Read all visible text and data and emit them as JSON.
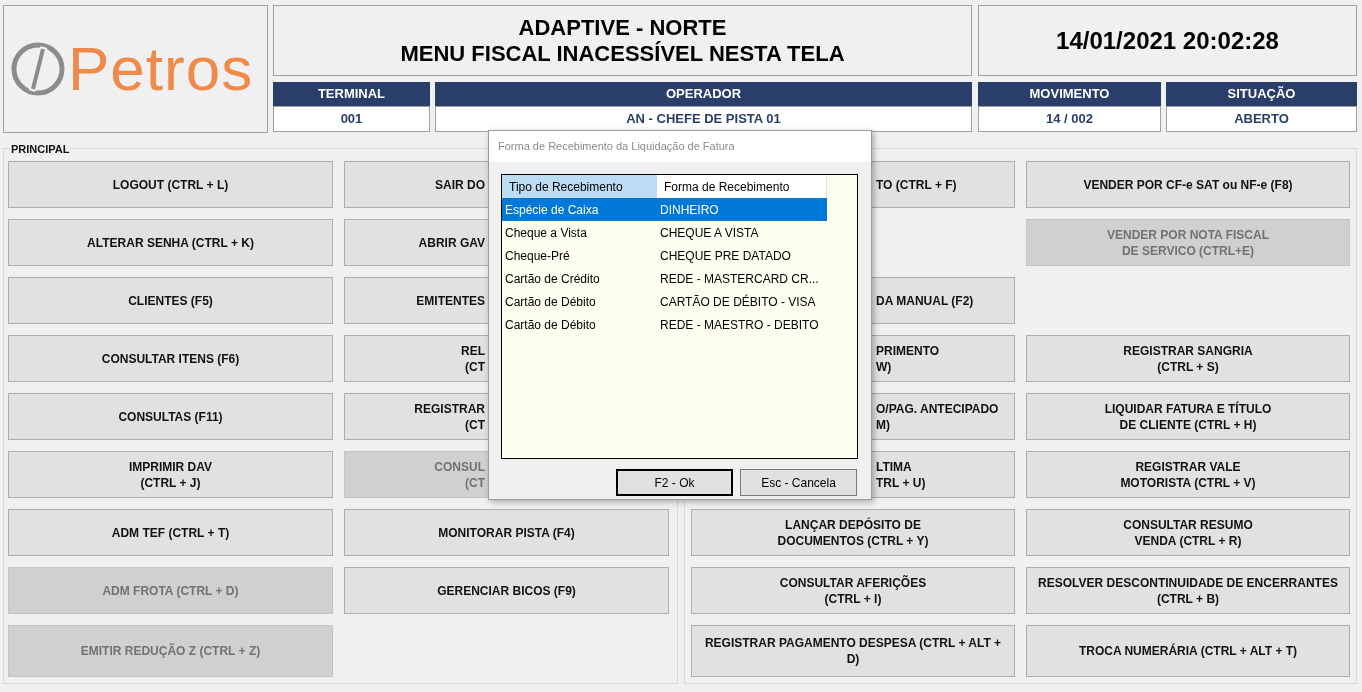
{
  "logo": {
    "text": "Petros"
  },
  "header": {
    "title_lines": [
      "ADAPTIVE - NORTE",
      "MENU FISCAL INACESSÍVEL NESTA TELA"
    ],
    "datetime": "14/01/2021 20:02:28"
  },
  "info": [
    {
      "label": "TERMINAL",
      "value": "001"
    },
    {
      "label": "OPERADOR",
      "value": "AN - CHEFE DE PISTA 01"
    },
    {
      "label": "MOVIMENTO",
      "value": "14 / 002"
    },
    {
      "label": "SITUAÇÃO",
      "value": "ABERTO"
    }
  ],
  "left_panel": {
    "title": "PRINCIPAL",
    "rows": [
      [
        {
          "kind": "full",
          "lines": [
            "LOGOUT (CTRL + L)"
          ],
          "disabled": false
        },
        {
          "kind": "cut_right",
          "lines": [
            "SAIR DO"
          ],
          "disabled": false
        }
      ],
      [
        {
          "kind": "full",
          "lines": [
            "ALTERAR SENHA (CTRL + K)"
          ],
          "disabled": false
        },
        {
          "kind": "cut_right",
          "lines": [
            "ABRIR GAV"
          ],
          "disabled": false
        }
      ],
      [
        {
          "kind": "full",
          "lines": [
            "CLIENTES (F5)"
          ],
          "disabled": false
        },
        {
          "kind": "cut_right",
          "lines": [
            "EMITENTES"
          ],
          "disabled": false
        }
      ],
      [
        {
          "kind": "full",
          "lines": [
            "CONSULTAR ITENS (F6)"
          ],
          "disabled": false
        },
        {
          "kind": "cut_right",
          "lines": [
            "REL",
            "(CT"
          ],
          "disabled": false
        }
      ],
      [
        {
          "kind": "full",
          "lines": [
            "CONSULTAS (F11)"
          ],
          "disabled": false
        },
        {
          "kind": "cut_right",
          "lines": [
            "REGISTRAR",
            "(CT"
          ],
          "disabled": false
        }
      ],
      [
        {
          "kind": "full",
          "lines": [
            "IMPRIMIR DAV",
            "(CTRL + J)"
          ],
          "disabled": false
        },
        {
          "kind": "cut_right",
          "lines": [
            "CONSUL",
            "(CT"
          ],
          "disabled": true
        }
      ],
      [
        {
          "kind": "full",
          "lines": [
            "ADM TEF (CTRL + T)"
          ],
          "disabled": false
        },
        {
          "kind": "full",
          "lines": [
            "MONITORAR PISTA (F4)"
          ],
          "disabled": false
        }
      ],
      [
        {
          "kind": "full",
          "lines": [
            "ADM FROTA (CTRL + D)"
          ],
          "disabled": true
        },
        {
          "kind": "full",
          "lines": [
            "GERENCIAR BICOS (F9)"
          ],
          "disabled": false
        }
      ],
      [
        {
          "kind": "full",
          "lines": [
            "EMITIR REDUÇÃO Z (CTRL + Z)"
          ],
          "disabled": true
        },
        {
          "kind": "blank"
        }
      ]
    ]
  },
  "right_panel": {
    "rows": [
      [
        {
          "kind": "cut_left",
          "lines": [
            "TO (CTRL + F)"
          ],
          "disabled": false
        },
        {
          "kind": "full",
          "lines": [
            "VENDER POR CF-e SAT ou NF-e (F8)"
          ],
          "disabled": false
        }
      ],
      [
        {
          "kind": "blank"
        },
        {
          "kind": "full",
          "lines": [
            "VENDER POR NOTA FISCAL",
            "DE SERVICO (CTRL+E)"
          ],
          "disabled": true
        }
      ],
      [
        {
          "kind": "cut_left",
          "lines": [
            "DA MANUAL (F2)"
          ],
          "disabled": false
        },
        {
          "kind": "blank"
        }
      ],
      [
        {
          "kind": "cut_left",
          "lines": [
            "PRIMENTO",
            "W)"
          ],
          "disabled": false
        },
        {
          "kind": "full",
          "lines": [
            "REGISTRAR SANGRIA",
            "(CTRL + S)"
          ],
          "disabled": false
        }
      ],
      [
        {
          "kind": "cut_left",
          "lines": [
            "O/PAG. ANTECIPADO",
            "M)"
          ],
          "disabled": false
        },
        {
          "kind": "full",
          "lines": [
            "LIQUIDAR FATURA E TÍTULO",
            "DE CLIENTE (CTRL + H)"
          ],
          "disabled": false
        }
      ],
      [
        {
          "kind": "cut_left",
          "lines": [
            "LTIMA",
            "TRL + U)"
          ],
          "disabled": false
        },
        {
          "kind": "full",
          "lines": [
            "REGISTRAR VALE",
            "MOTORISTA (CTRL + V)"
          ],
          "disabled": false
        }
      ],
      [
        {
          "kind": "full",
          "lines": [
            "LANÇAR DEPÓSITO DE",
            "DOCUMENTOS (CTRL + Y)"
          ],
          "disabled": false
        },
        {
          "kind": "full",
          "lines": [
            "CONSULTAR RESUMO",
            "VENDA (CTRL + R)"
          ],
          "disabled": false
        }
      ],
      [
        {
          "kind": "full",
          "lines": [
            "CONSULTAR AFERIÇÕES",
            "(CTRL + I)"
          ],
          "disabled": false
        },
        {
          "kind": "full",
          "lines": [
            "RESOLVER DESCONTINUIDADE DE ENCERRANTES",
            "(CTRL + B)"
          ],
          "disabled": false
        }
      ],
      [
        {
          "kind": "full",
          "lines": [
            "REGISTRAR PAGAMENTO DESPESA (CTRL + ALT +",
            "D)"
          ],
          "disabled": false
        },
        {
          "kind": "full",
          "lines": [
            "TROCA NUMERÁRIA (CTRL + ALT + T)"
          ],
          "disabled": false
        }
      ]
    ]
  },
  "dialog": {
    "title": "Forma de Recebimento da Liquidação de Fatura",
    "columns": [
      {
        "label": "Tipo de Recebimento",
        "selected": true
      },
      {
        "label": "Forma de Recebimento",
        "selected": false
      }
    ],
    "rows": [
      {
        "tipo": "Espécie de Caixa",
        "forma": "DINHEIRO",
        "selected": true
      },
      {
        "tipo": "Cheque a Vista",
        "forma": "CHEQUE A VISTA",
        "selected": false
      },
      {
        "tipo": "Cheque-Pré",
        "forma": "CHEQUE PRE DATADO",
        "selected": false
      },
      {
        "tipo": "Cartão de Crédito",
        "forma": "REDE - MASTERCARD CR...",
        "selected": false
      },
      {
        "tipo": "Cartão de Débito",
        "forma": "CARTÃO DE DÉBITO - VISA",
        "selected": false
      },
      {
        "tipo": "Cartão de Débito",
        "forma": "REDE - MAESTRO - DEBITO",
        "selected": false
      }
    ],
    "buttons": [
      {
        "label": "F2 - Ok",
        "default": true
      },
      {
        "label": "Esc - Cancela",
        "default": false
      }
    ]
  }
}
